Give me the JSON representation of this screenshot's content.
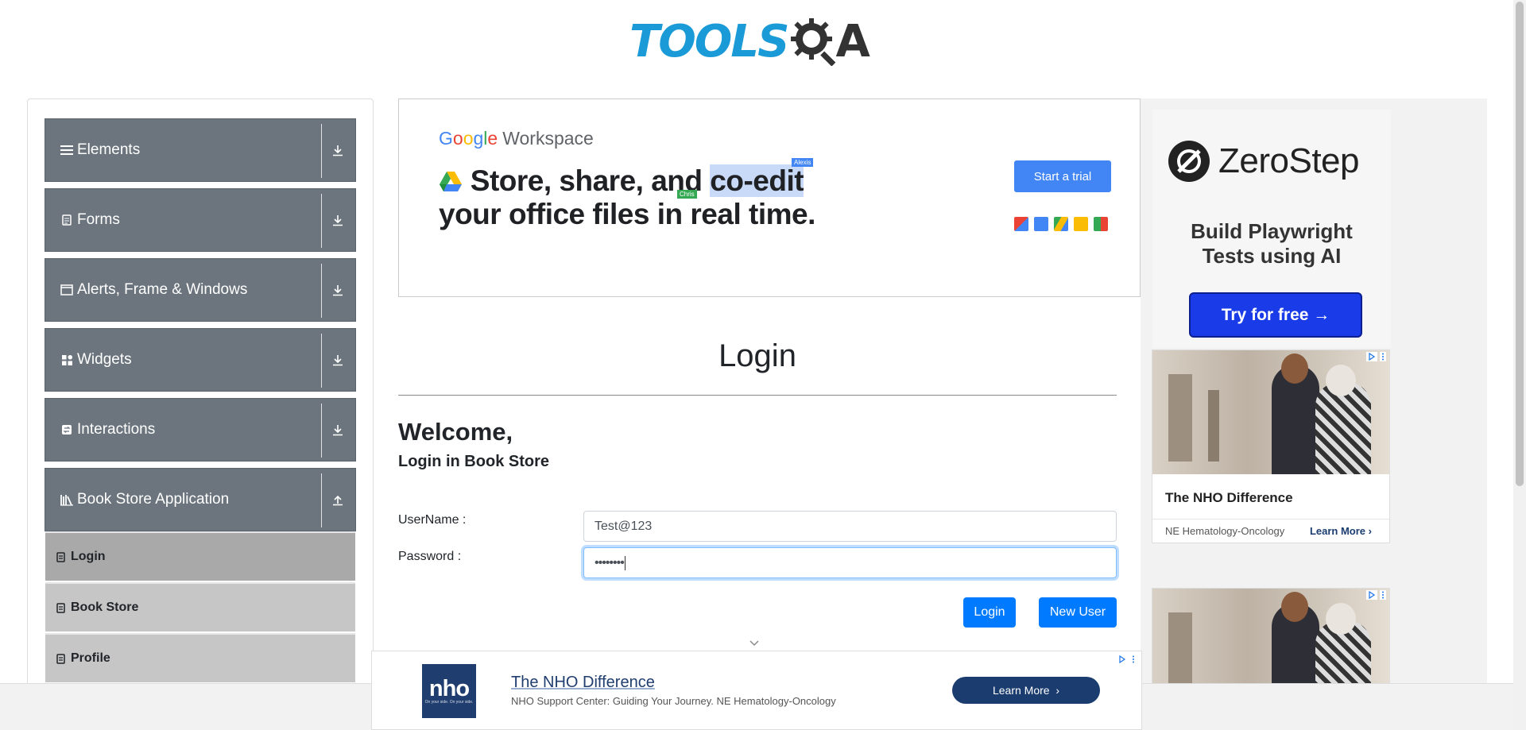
{
  "header": {
    "logo_text": "TOOLS",
    "logo_suffix": "A"
  },
  "sidebar": {
    "groups": [
      {
        "label": "Elements",
        "icon": "hamburger-icon",
        "expand": "download-arrow"
      },
      {
        "label": "Forms",
        "icon": "form-icon",
        "expand": "download-arrow"
      },
      {
        "label": "Alerts, Frame & Windows",
        "icon": "window-icon",
        "expand": "download-arrow"
      },
      {
        "label": "Widgets",
        "icon": "widgets-icon",
        "expand": "download-arrow"
      },
      {
        "label": "Interactions",
        "icon": "interactions-icon",
        "expand": "download-arrow"
      },
      {
        "label": "Book Store Application",
        "icon": "books-icon",
        "expand": "upload-arrow"
      }
    ],
    "items": [
      {
        "label": "Login",
        "active": true
      },
      {
        "label": "Book Store",
        "active": false
      },
      {
        "label": "Profile",
        "active": false
      }
    ]
  },
  "top_ad": {
    "brand_letters": [
      "G",
      "o",
      "o",
      "g",
      "l",
      "e"
    ],
    "brand_colors": [
      "#4285f4",
      "#ea4335",
      "#fbbc05",
      "#4285f4",
      "#34a853",
      "#ea4335"
    ],
    "product": "Workspace",
    "headline_line1_a": "Store, share, and ",
    "headline_line1_b": "co-edit",
    "headline_line2_a": "your office files in ",
    "headline_line2_b": "real time.",
    "tag_alexis": "Alexis",
    "tag_chris": "Chris",
    "cta": "Start a trial"
  },
  "main": {
    "title": "Login",
    "welcome": "Welcome,",
    "subtitle": "Login in Book Store",
    "username_label": "UserName :",
    "username_value": "Test@123",
    "password_label": "Password :",
    "password_value": "••••••••",
    "login_button": "Login",
    "new_user_button": "New User"
  },
  "right_ad": {
    "brand": "ZeroStep",
    "tagline_line1": "Build Playwright",
    "tagline_line2": "Tests using AI",
    "cta": "Try for free →",
    "card_title": "The NHO Difference",
    "card_source": "NE Hematology-Oncology",
    "card_cta": "Learn More"
  },
  "bottom_ad": {
    "logo": "nho",
    "logo_sub": "On your side. On your side.",
    "title": "The NHO Difference",
    "description": "NHO Support Center: Guiding Your Journey. NE Hematology-Oncology",
    "cta": "Learn More"
  },
  "colors": {
    "accent": "#007bff",
    "sidebar_group": "#6c757d",
    "sub_active": "#a9a9a9",
    "sub_item": "#c6c6c6"
  }
}
